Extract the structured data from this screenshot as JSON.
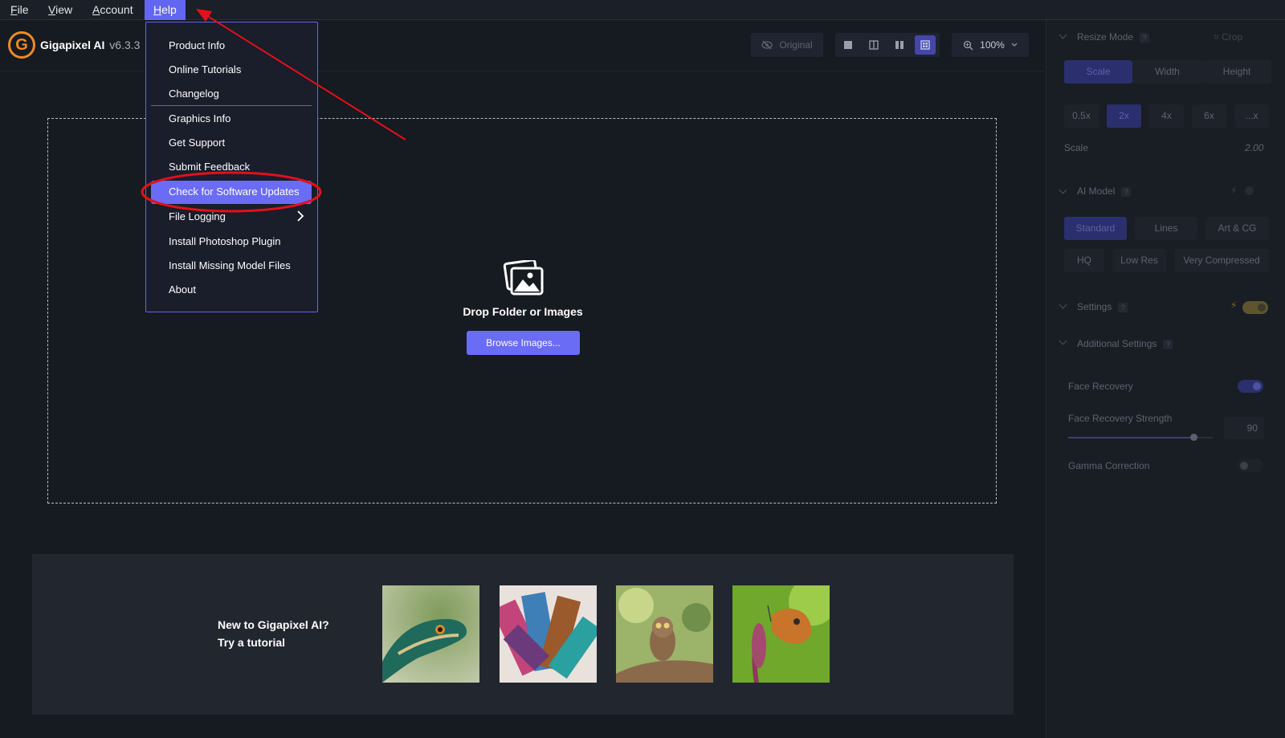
{
  "menubar": {
    "items": [
      {
        "label": "File",
        "underline": "F",
        "rest": "ile"
      },
      {
        "label": "View",
        "underline": "V",
        "rest": "iew"
      },
      {
        "label": "Account",
        "underline": "A",
        "rest": "ccount"
      },
      {
        "label": "Help",
        "underline": "H",
        "rest": "elp"
      }
    ],
    "active": "Help"
  },
  "header": {
    "logo_letter": "G",
    "app_name": "Gigapixel AI",
    "version": "v6.3.3"
  },
  "toolbar": {
    "original_label": "Original",
    "zoom_label": "100%",
    "view_buttons": [
      "single-view-icon",
      "split-view-icon",
      "side-by-side-icon",
      "grid-view-icon"
    ],
    "active_view": "grid-view-icon"
  },
  "help_menu": {
    "items": [
      "Product Info",
      "Online Tutorials",
      "Changelog",
      "Graphics Info",
      "Get Support",
      "Submit Feedback",
      "Check for Software Updates",
      "File Logging",
      "Install Photoshop Plugin",
      "Install Missing Model Files",
      "About"
    ],
    "highlighted": "Check for Software Updates"
  },
  "dropzone": {
    "label": "Drop Folder or Images",
    "button": "Browse Images..."
  },
  "tutorial": {
    "question": "New to Gigapixel AI?",
    "cta": "Try a tutorial",
    "thumbnails": [
      "lizard",
      "paint brushes",
      "owl",
      "butterfly"
    ]
  },
  "right_panel": {
    "resize_mode": {
      "title": "Resize Mode",
      "crop_label": "Crop",
      "tabs": [
        "Scale",
        "Width",
        "Height"
      ],
      "active_tab": "Scale",
      "scales": [
        "0.5x",
        "2x",
        "4x",
        "6x",
        "...x"
      ],
      "active_scale": "2x",
      "scale_label": "Scale",
      "scale_value": "2.00"
    },
    "ai_model": {
      "title": "AI Model",
      "row1": [
        "Standard",
        "Lines",
        "Art & CG"
      ],
      "row2": [
        "HQ",
        "Low Res",
        "Very Compressed"
      ],
      "active": "Standard"
    },
    "settings": {
      "title": "Settings"
    },
    "additional": {
      "title": "Additional Settings",
      "face_recovery": "Face Recovery",
      "face_recovery_on": true,
      "strength_label": "Face Recovery Strength",
      "strength_value": "90",
      "gamma": "Gamma Correction",
      "gamma_on": false
    }
  },
  "colors": {
    "accent": "#6366f1",
    "annotation_red": "#e3101a",
    "brand_orange": "#f08a24"
  }
}
